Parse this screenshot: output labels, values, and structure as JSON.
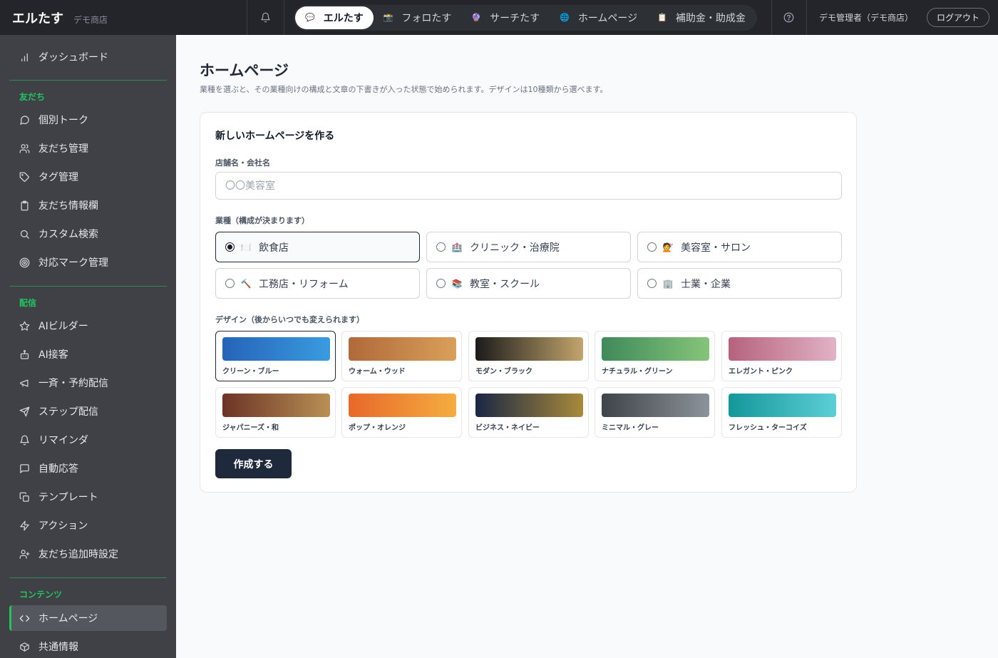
{
  "header": {
    "brand": "エルたす",
    "subtitle": "デモ商店",
    "tabs": [
      {
        "icon": "💬",
        "label": "エルたす"
      },
      {
        "icon": "📸",
        "label": "フォロたす"
      },
      {
        "icon": "🔮",
        "label": "サーチたす"
      },
      {
        "icon": "🌐",
        "label": "ホームページ"
      },
      {
        "icon": "📋",
        "label": "補助金・助成金"
      }
    ],
    "user": "デモ管理者（デモ商店）",
    "logout": "ログアウト"
  },
  "sidebar": {
    "dashboard": "ダッシュボード",
    "sections": {
      "friends": "友だち",
      "delivery": "配信",
      "contents": "コンテンツ"
    },
    "friends_items": [
      "個別トーク",
      "友だち管理",
      "タグ管理",
      "友だち情報欄",
      "カスタム検索",
      "対応マーク管理"
    ],
    "delivery_items": [
      "AIビルダー",
      "AI接客",
      "一斉・予約配信",
      "ステップ配信",
      "リマインダ",
      "自動応答",
      "テンプレート",
      "アクション",
      "友だち追加時設定"
    ],
    "contents_items": [
      "ホームページ",
      "共通情報"
    ]
  },
  "main": {
    "title": "ホームページ",
    "description": "業種を選ぶと、その業種向けの構成と文章の下書きが入った状態で始められます。デザインは10種類から選べます。",
    "card_title": "新しいホームページを作る",
    "name_label": "店舗名・会社名",
    "name_placeholder": "〇〇美容室",
    "industry_label": "業種（構成が決まります）",
    "industries": [
      {
        "emoji": "🍽️",
        "label": "飲食店"
      },
      {
        "emoji": "🏥",
        "label": "クリニック・治療院"
      },
      {
        "emoji": "💇",
        "label": "美容室・サロン"
      },
      {
        "emoji": "🔨",
        "label": "工務店・リフォーム"
      },
      {
        "emoji": "📚",
        "label": "教室・スクール"
      },
      {
        "emoji": "🏢",
        "label": "士業・企業"
      }
    ],
    "selected_industry": "飲食店",
    "design_label": "デザイン（後からいつでも変えられます）",
    "designs": [
      {
        "name": "クリーン・ブルー",
        "from": "#2563b8",
        "to": "#3a9be0"
      },
      {
        "name": "ウォーム・ウッド",
        "from": "#b0693a",
        "to": "#d9a05a"
      },
      {
        "name": "モダン・ブラック",
        "from": "#1b1b1b",
        "to": "#c3a56c"
      },
      {
        "name": "ナチュラル・グリーン",
        "from": "#3f8a5a",
        "to": "#86c47a"
      },
      {
        "name": "エレガント・ピンク",
        "from": "#b5627d",
        "to": "#e2b2c4"
      },
      {
        "name": "ジャパニーズ・和",
        "from": "#6b3326",
        "to": "#b99055"
      },
      {
        "name": "ポップ・オレンジ",
        "from": "#e8682a",
        "to": "#f5ad40"
      },
      {
        "name": "ビジネス・ネイビー",
        "from": "#1a2744",
        "to": "#a98a3b"
      },
      {
        "name": "ミニマル・グレー",
        "from": "#3f434a",
        "to": "#8d939a"
      },
      {
        "name": "フレッシュ・ターコイズ",
        "from": "#14979a",
        "to": "#5ccfd6"
      }
    ],
    "selected_design": "クリーン・ブルー",
    "create_button": "作成する"
  }
}
